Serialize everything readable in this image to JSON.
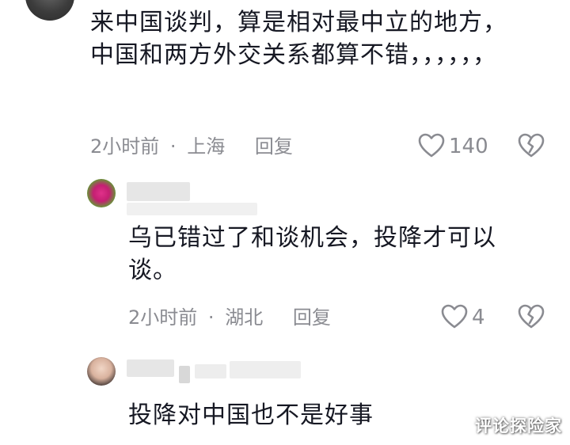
{
  "top_comment": {
    "text": "来中国谈判，算是相对最中立的地方，中国和两方外交关系都算不错，，，，，，",
    "time": "2小时前",
    "location": "上海",
    "reply_label": "回复",
    "like_count": "140"
  },
  "replies": [
    {
      "text": "乌已错过了和谈机会，投降才可以谈。",
      "time": "2小时前",
      "location": "湖北",
      "reply_label": "回复",
      "like_count": "4"
    },
    {
      "text": "投降对中国也不是好事"
    }
  ],
  "meta_separator": "·",
  "watermark": "评论探险家",
  "icons": {
    "like": "heart-outline-icon",
    "dislike": "broken-heart-icon"
  }
}
